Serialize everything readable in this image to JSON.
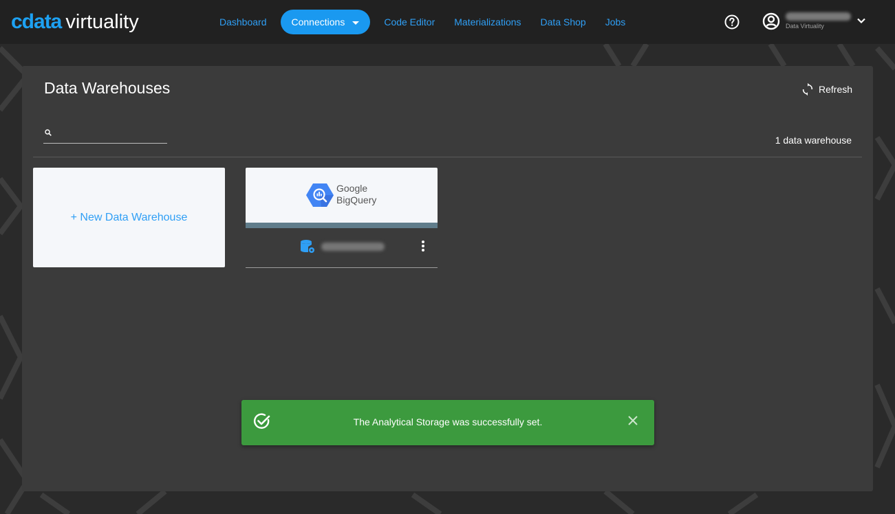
{
  "app": {
    "brand_mark": "cdata",
    "brand_name": "virtuality"
  },
  "nav": {
    "items": [
      {
        "label": "Dashboard"
      },
      {
        "label": "Connections"
      },
      {
        "label": "Code Editor"
      },
      {
        "label": "Materializations"
      },
      {
        "label": "Data Shop"
      },
      {
        "label": "Jobs"
      }
    ],
    "active": "Connections"
  },
  "user": {
    "org": "Data Virtuality"
  },
  "page": {
    "title": "Data Warehouses",
    "refresh_label": "Refresh",
    "count_text": "1 data warehouse"
  },
  "cards": {
    "new_label": "+ New Data Warehouse",
    "warehouse": {
      "vendor_line1": "Google",
      "vendor_line2": "BigQuery"
    }
  },
  "toast": {
    "message": "The Analytical Storage was successfully set.",
    "color": "#3c9a3e"
  },
  "colors": {
    "accent": "#1a99f0",
    "link": "#2f9ff5",
    "panel": "#3b3b3b",
    "topbar": "#212121"
  }
}
